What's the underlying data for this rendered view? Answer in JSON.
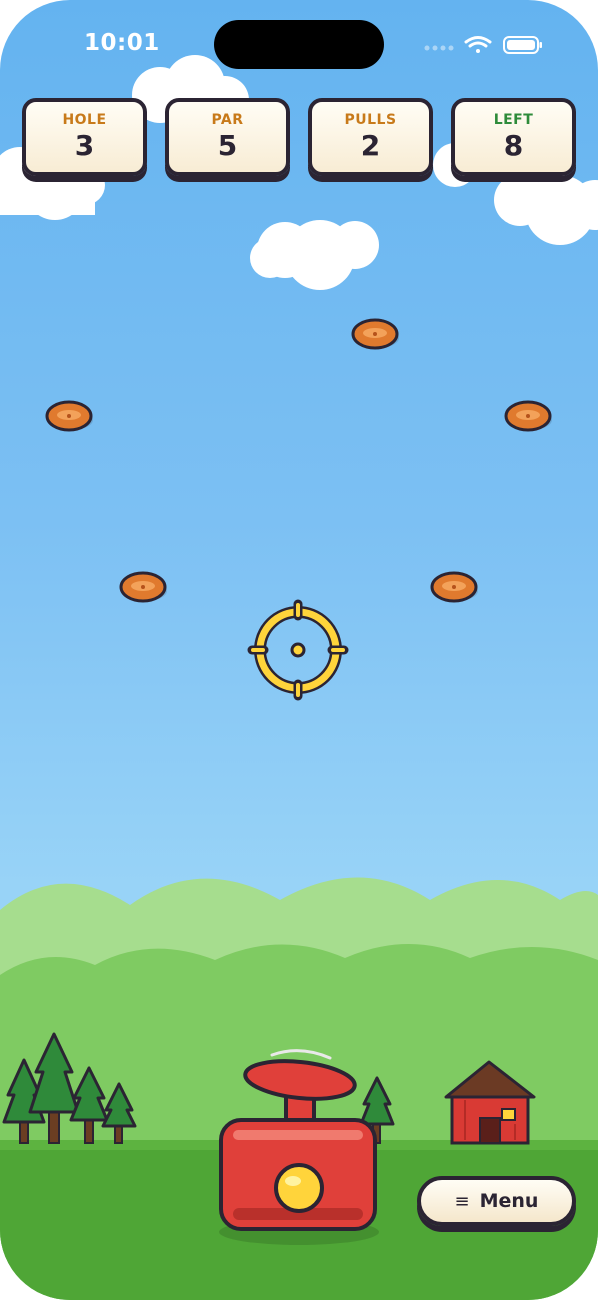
{
  "status_bar": {
    "time": "10:01"
  },
  "hud": [
    {
      "label": "HOLE",
      "value": "3",
      "label_color": "#c87a1a"
    },
    {
      "label": "PAR",
      "value": "5",
      "label_color": "#c87a1a"
    },
    {
      "label": "PULLS",
      "value": "2",
      "label_color": "#c87a1a"
    },
    {
      "label": "LEFT",
      "value": "8",
      "label_color": "#2e8b3a"
    }
  ],
  "menu": {
    "icon": "≡",
    "label": "Menu"
  },
  "colors": {
    "outline": "#2b2433",
    "clay": "#e07a2e",
    "crosshair": "#ffd43b",
    "launcher": "#e0403a",
    "barn": "#d93a34",
    "grass": "#4fa636"
  }
}
